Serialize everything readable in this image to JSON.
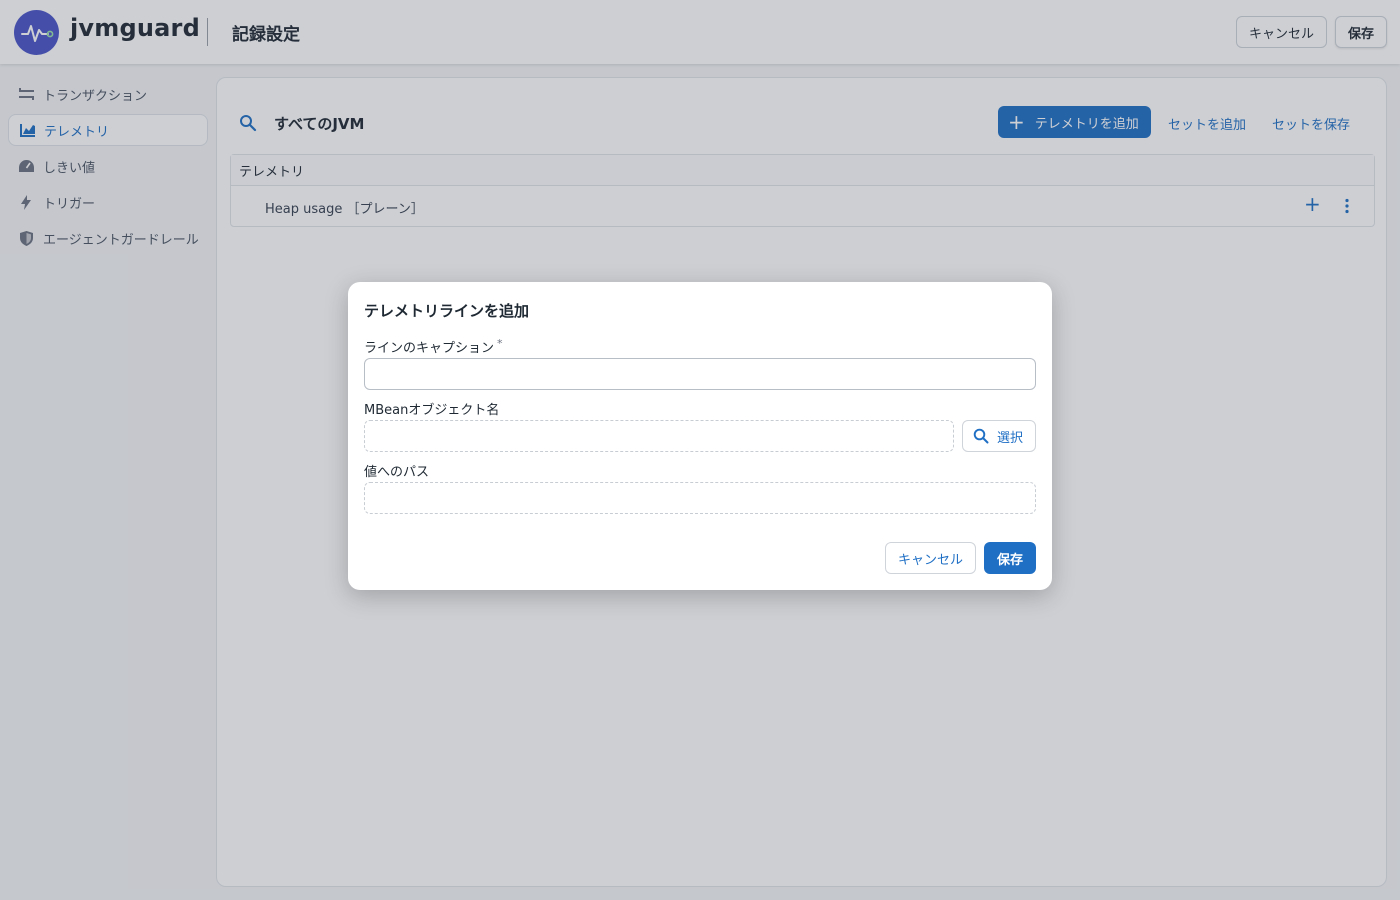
{
  "header": {
    "brand": "jvmguard",
    "title": "記録設定",
    "cancel_label": "キャンセル",
    "save_label": "保存"
  },
  "sidebar": {
    "items": [
      {
        "label": "トランザクション",
        "icon": "transactions-icon",
        "active": false
      },
      {
        "label": "テレメトリ",
        "icon": "chart-icon",
        "active": true
      },
      {
        "label": "しきい値",
        "icon": "gauge-icon",
        "active": false
      },
      {
        "label": "トリガー",
        "icon": "bolt-icon",
        "active": false
      },
      {
        "label": "エージェントガードレール",
        "icon": "shield-icon",
        "active": false
      }
    ]
  },
  "main": {
    "scope_title": "すべてのJVM",
    "add_telemetry_label": "テレメトリを追加",
    "add_set_label": "セットを追加",
    "save_set_label": "セットを保存",
    "table": {
      "header": "テレメトリ",
      "rows": [
        {
          "label": "Heap usage ［プレーン］"
        }
      ]
    }
  },
  "modal": {
    "title": "テレメトリラインを追加",
    "caption_label": "ラインのキャプション",
    "required_mark": "*",
    "caption_value": "",
    "mbean_label": "MBeanオブジェクト名",
    "mbean_value": "",
    "select_label": "選択",
    "path_label": "値へのパス",
    "path_value": "",
    "cancel_label": "キャンセル",
    "save_label": "保存"
  },
  "colors": {
    "accent": "#1f6fc5",
    "logo": "#4a55c8"
  }
}
